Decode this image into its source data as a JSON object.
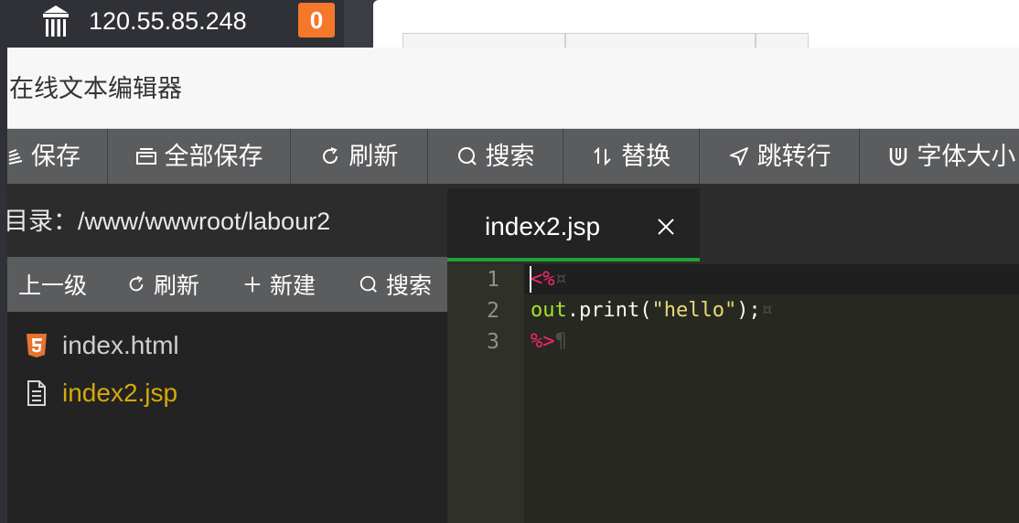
{
  "server": {
    "ip": "120.55.85.248",
    "badge_count": "0"
  },
  "window": {
    "title": "在线文本编辑器"
  },
  "toolbar": {
    "save": "保存",
    "save_all": "全部保存",
    "refresh": "刷新",
    "search": "搜索",
    "replace": "替换",
    "goto_line": "跳转行",
    "font_size": "字体大小"
  },
  "sidebar": {
    "directory": "目录：/www/wwwroot/labour2",
    "tools": {
      "up": "上一级",
      "refresh": "刷新",
      "new": "新建",
      "search": "搜索"
    },
    "files": [
      {
        "name": "index.html",
        "icon": "html5-icon",
        "color": "#cfcfcf"
      },
      {
        "name": "index2.jsp",
        "icon": "document-icon",
        "color": "#d4a90a"
      }
    ]
  },
  "editor": {
    "active_tab": "index2.jsp",
    "line_numbers": [
      "1",
      "2",
      "3"
    ],
    "lines": [
      {
        "open_tag": "<%",
        "eol": "¤"
      },
      {
        "object": "out",
        "call": ".print(",
        "string": "\"hello\"",
        "tail": ");",
        "eol": "¤"
      },
      {
        "close_tag": "%>",
        "eol": "¶"
      }
    ]
  },
  "colors": {
    "accent_green": "#1aa33a",
    "badge_orange": "#f5772a",
    "toolbar_gray": "#5b5c5e",
    "editor_bg": "#272822"
  }
}
